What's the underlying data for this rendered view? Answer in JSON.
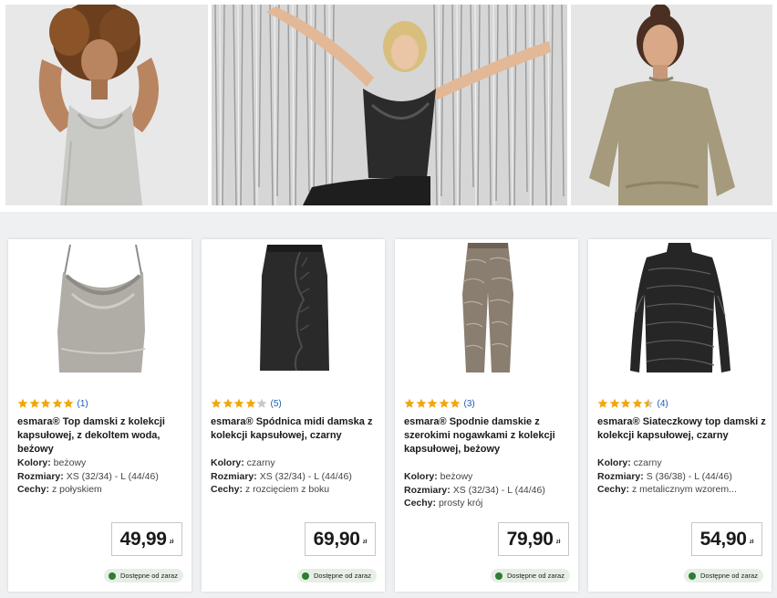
{
  "colors": {
    "star": "#f2a60d",
    "star_empty": "#c8c8c8",
    "available_dot": "#2e7d32",
    "link": "#1b5cb8"
  },
  "labels": {
    "colors": "Kolory:",
    "sizes": "Rozmiary:",
    "features": "Cechy:"
  },
  "products": [
    {
      "rating": 5,
      "rating_count": "(1)",
      "title": "esmara® Top damski z kolekcji kapsułowej, z dekoltem woda, beżowy",
      "colors": "beżowy",
      "sizes": "XS (32/34) - L (44/46)",
      "features": "z połyskiem",
      "price": "49,99",
      "currency": "zł",
      "availability": "Dostępne od zaraz"
    },
    {
      "rating": 4,
      "rating_count": "(5)",
      "title": "esmara® Spódnica midi damska z kolekcji kapsułowej, czarny",
      "colors": "czarny",
      "sizes": "XS (32/34) - L (44/46)",
      "features": "z rozcięciem z boku",
      "price": "69,90",
      "currency": "zł",
      "availability": "Dostępne od zaraz"
    },
    {
      "rating": 5,
      "rating_count": "(3)",
      "title": "esmara® Spodnie damskie z szerokimi nogawkami z kolekcji kapsułowej, beżowy",
      "colors": "beżowy",
      "sizes": "XS (32/34) - L (44/46)",
      "features": "prosty krój",
      "price": "79,90",
      "currency": "zł",
      "availability": "Dostępne od zaraz"
    },
    {
      "rating": 4.5,
      "rating_count": "(4)",
      "title": "esmara® Siateczkowy top damski z kolekcji kapsułowej, czarny",
      "colors": "czarny",
      "sizes": "S (36/38) - L (44/46)",
      "features": "z metalicznym wzorem...",
      "price": "54,90",
      "currency": "zł",
      "availability": "Dostępne od zaraz"
    }
  ]
}
